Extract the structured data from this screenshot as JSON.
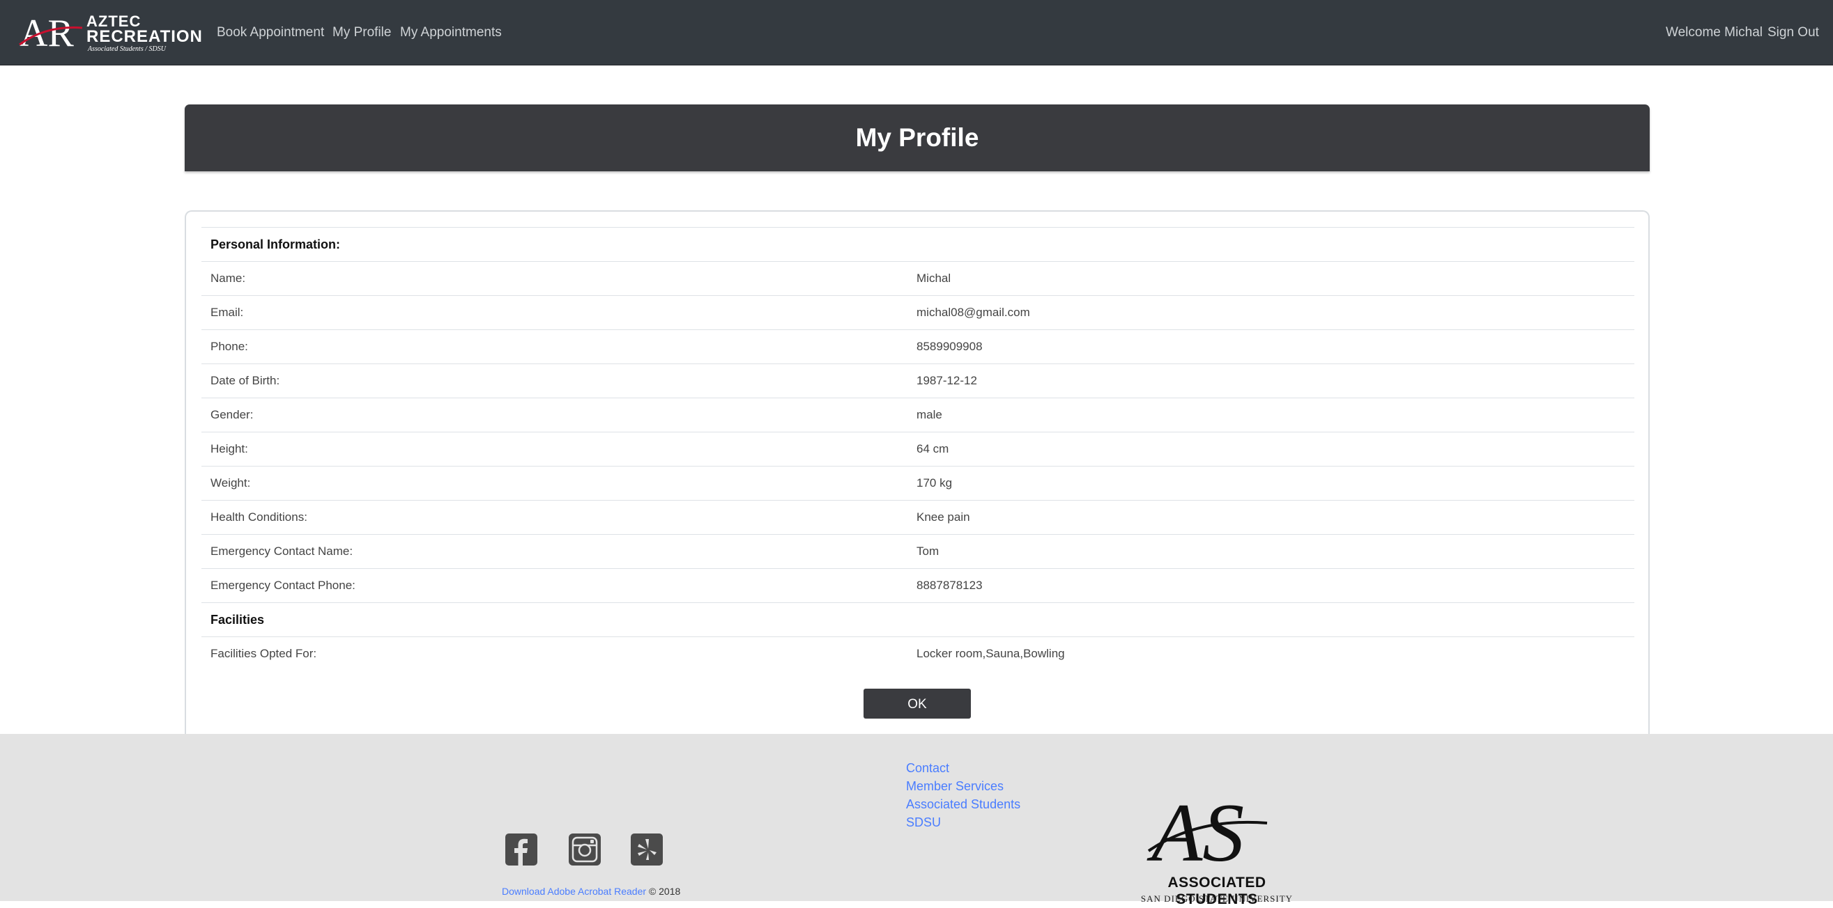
{
  "nav": {
    "brand_monogram": "AR",
    "brand_line1": "AZTEC",
    "brand_line2": "RECREATION",
    "brand_line3": "Associated Students / SDSU",
    "links": [
      "Book Appointment",
      "My Profile",
      "My Appointments"
    ],
    "welcome": "Welcome Michal",
    "signout": "Sign Out"
  },
  "page": {
    "title": "My Profile"
  },
  "profile": {
    "personal_heading": "Personal Information:",
    "rows": [
      {
        "label": "Name:",
        "value": "Michal"
      },
      {
        "label": "Email:",
        "value": "michal08@gmail.com"
      },
      {
        "label": "Phone:",
        "value": "8589909908"
      },
      {
        "label": "Date of Birth:",
        "value": "1987-12-12"
      },
      {
        "label": "Gender:",
        "value": "male"
      },
      {
        "label": "Height:",
        "value": "64 cm"
      },
      {
        "label": "Weight:",
        "value": "170 kg"
      },
      {
        "label": "Health Conditions:",
        "value": "Knee pain"
      },
      {
        "label": "Emergency Contact Name:",
        "value": "Tom"
      },
      {
        "label": "Emergency Contact Phone:",
        "value": "8887878123"
      }
    ],
    "facilities_heading": "Facilities",
    "facilities_label": "Facilities Opted For:",
    "facilities_value": "Locker room,Sauna,Bowling",
    "ok_label": "OK"
  },
  "footer": {
    "links": [
      "Contact",
      "Member Services",
      "Associated Students",
      "SDSU"
    ],
    "social_icons": [
      "facebook-icon",
      "instagram-icon",
      "yelp-icon"
    ],
    "as_logo_monogram": "AS",
    "as_logo_title": "ASSOCIATED STUDENTS",
    "as_logo_subtitle": "SAN DIEGO STATE UNIVERSITY",
    "acrobat_link": "Download Adobe Acrobat Reader",
    "copyright": "© 2018"
  },
  "colors": {
    "navbar": "#343a40",
    "title_bar": "#3a3b3f",
    "footer_bg": "#e3e3e3",
    "link": "#4a7dff"
  }
}
